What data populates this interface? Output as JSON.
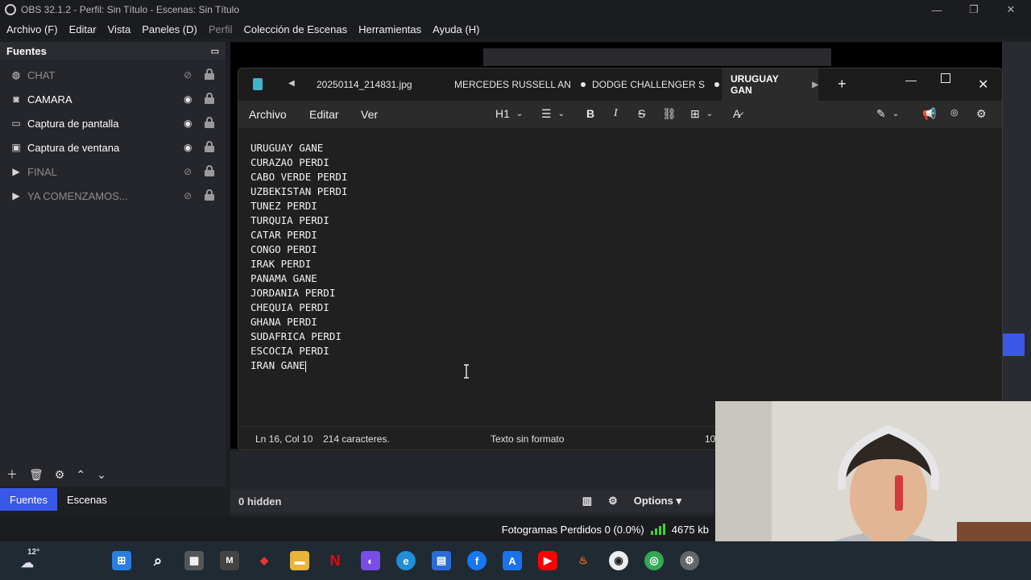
{
  "obs": {
    "title": "OBS 32.1.2 - Perfil: Sin Título - Escenas: Sin Título",
    "menu": [
      "Archivo (F)",
      "Editar",
      "Vista",
      "Paneles (D)",
      "Perfil",
      "Colección de Escenas",
      "Herramientas",
      "Ayuda (H)"
    ],
    "sources_title": "Fuentes",
    "sources": [
      {
        "label": "CHAT",
        "icon": "globe-icon",
        "visible": false
      },
      {
        "label": "CAMARA",
        "icon": "camera-icon",
        "visible": true
      },
      {
        "label": "Captura de pantalla",
        "icon": "monitor-icon",
        "visible": true
      },
      {
        "label": "Captura de ventana",
        "icon": "window-icon",
        "visible": true
      },
      {
        "label": "FINAL",
        "icon": "play-icon",
        "visible": false
      },
      {
        "label": "YA COMENZAMOS...",
        "icon": "play-icon",
        "visible": false
      }
    ],
    "dock_tabs": [
      "Fuentes",
      "Escenas"
    ],
    "hidden_label": "0 hidden",
    "options_label": "Options",
    "status": {
      "dropped_frames": "Fotogramas Perdidos 0 (0.0%)",
      "bitrate": "4675 kb"
    }
  },
  "notepad": {
    "tabs": [
      "20250114_214831.jpg",
      "MERCEDES RUSSELL AN",
      "DODGE CHALLENGER S",
      "URUGUAY GAN"
    ],
    "menu": [
      "Archivo",
      "Editar",
      "Ver"
    ],
    "heading_selector": "H1",
    "lines": [
      "URUGUAY GANE",
      "CURAZAO PERDI",
      "CABO VERDE PERDI",
      "UZBEKISTAN PERDI",
      "TUNEZ PERDI",
      "TURQUIA PERDI",
      "CATAR PERDI",
      "CONGO PERDI",
      "IRAK PERDI",
      "PANAMA GANE",
      "JORDANIA PERDI",
      "CHEQUIA PERDI",
      "GHANA PERDI",
      "SUDAFRICA PERDI",
      "ESCOCIA PERDI",
      "IRAN GANE"
    ],
    "status": {
      "position": "Ln 16, Col 10",
      "chars": "214 caracteres.",
      "format": "Texto sin formato",
      "zoom": "10"
    }
  },
  "taskbar": {
    "weather": "12°"
  }
}
